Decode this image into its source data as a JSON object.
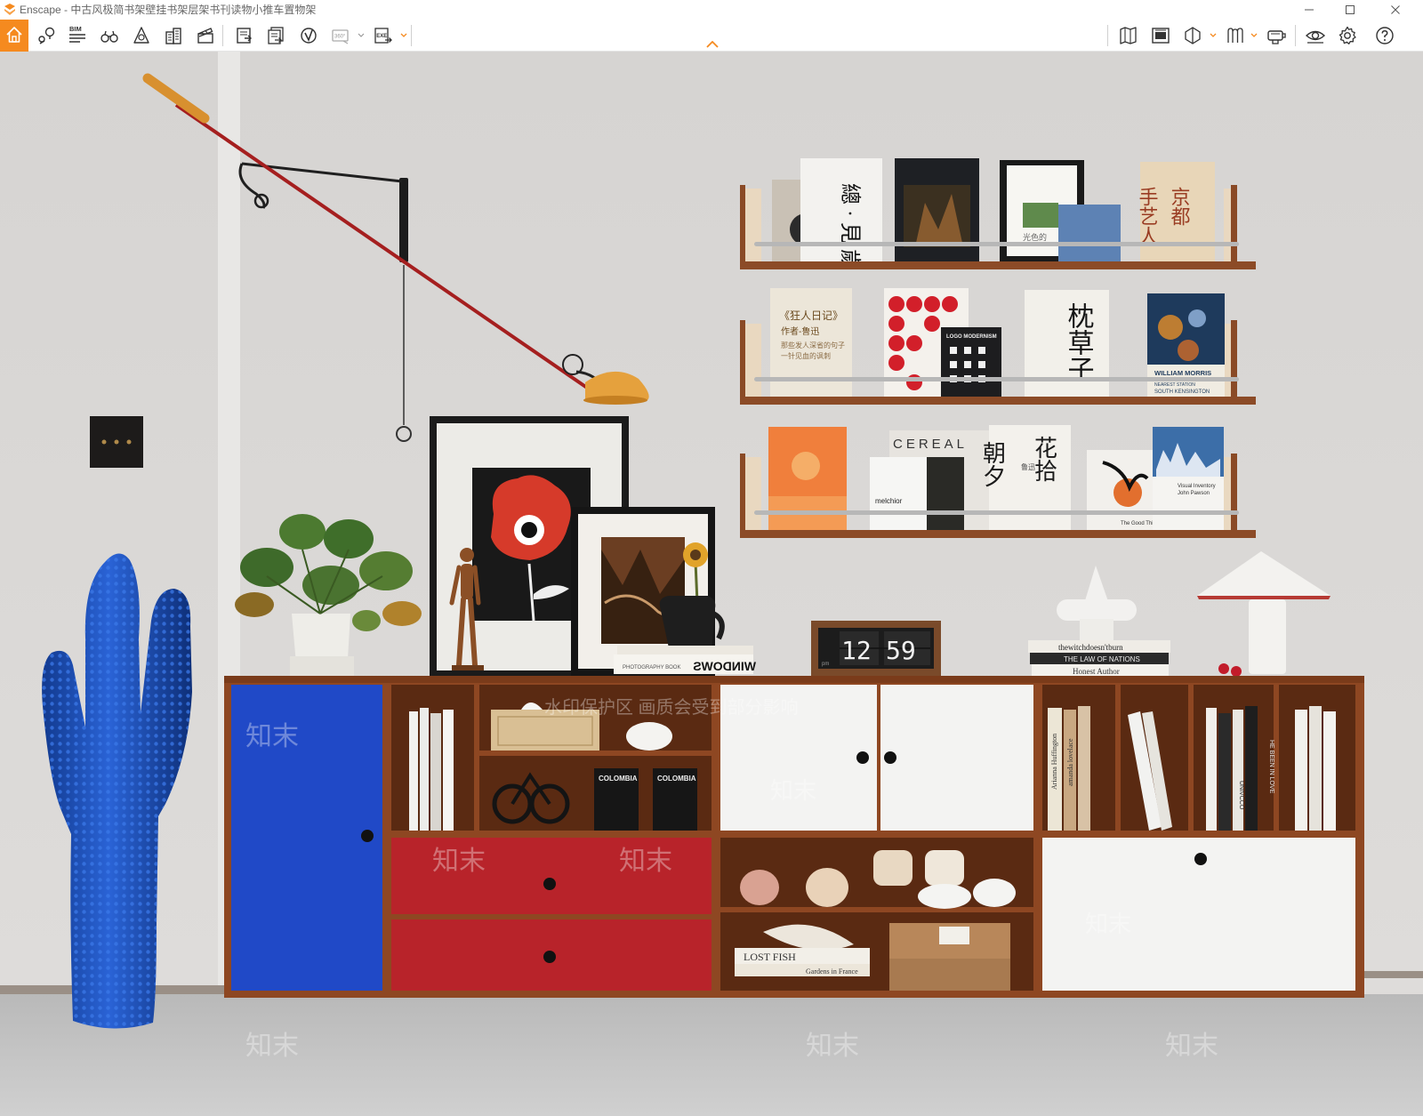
{
  "window": {
    "title": "Enscape - 中古风极简书架壁挂书架层架书刊读物小推车置物架",
    "accent_color": "#f58a1f"
  },
  "toolbar": {
    "left_tools": [
      {
        "icon": "home-icon"
      },
      {
        "icon": "map-pin-icon"
      },
      {
        "icon": "bim-info-icon",
        "label": "BIM"
      },
      {
        "icon": "binoculars-icon"
      },
      {
        "icon": "atmosphere-icon"
      },
      {
        "icon": "buildings-icon"
      },
      {
        "icon": "clapperboard-icon"
      },
      {
        "icon": "screenshot-icon"
      },
      {
        "icon": "batch-render-icon"
      },
      {
        "icon": "web-export-icon"
      },
      {
        "icon": "panorama-360-icon",
        "label": "360°"
      },
      {
        "icon": "exe-export-icon",
        "label": "EXE"
      }
    ],
    "right_tools": [
      {
        "icon": "book-map-icon"
      },
      {
        "icon": "views-icon"
      },
      {
        "icon": "section-icon"
      },
      {
        "icon": "asset-library-icon"
      },
      {
        "icon": "capture-icon"
      },
      {
        "icon": "visibility-eye-icon"
      },
      {
        "icon": "settings-gear-icon"
      },
      {
        "icon": "help-icon"
      }
    ]
  },
  "scene": {
    "clock": {
      "hour": "12",
      "minute": "59",
      "ampm": "pm"
    },
    "watermark": {
      "logo_text": "知末",
      "notice": "水印保护区  画质会受到部分影响"
    },
    "shelf_books": {
      "top": [
        {
          "text_vertical": "總  ·  見  歲"
        },
        {
          "text": ""
        },
        {
          "text": "光色的"
        },
        {
          "text_vertical_1": "手艺人",
          "text_vertical_2": "京都"
        }
      ],
      "middle": [
        {
          "title": "《狂人日记》",
          "author": "作者-鲁迅",
          "line1": "那些发人深省的句子",
          "line2": "一针见血的讽刺"
        },
        {
          "title": "LOGO MODERNISM"
        },
        {
          "text_vertical": "枕草子"
        },
        {
          "title": "WILLIAM MORRIS",
          "subtitle": "NEAREST  STATION",
          "subtitle2": "SOUTH KENSINGTON"
        }
      ],
      "bottom": [
        {
          "title": "CEREAL"
        },
        {
          "title": "melchior"
        },
        {
          "text_vertical_1": "朝夕",
          "text_vertical_2": "花拾",
          "author": "鲁迅"
        },
        {
          "title": "The Good Thing"
        },
        {
          "title": "Visual Inventory",
          "author": "John Pawson"
        }
      ]
    },
    "cabinet_books": {
      "counter_stack": [
        "thewitchdoesn'tburn",
        "THE LAW OF NATIONS",
        "Honest Author"
      ],
      "windows_stack": [
        "WINDOWS",
        "PHOTOGRAPHY BOOK"
      ],
      "right_spines": [
        "Arianna Huffington",
        "amanda lovelace",
        "UNIVCCO",
        "HE BEEN IN LOVE"
      ],
      "coffee_bags": [
        "COLOMBIA",
        "COLOMBIA"
      ],
      "cookbook_stack": [
        "LOST FISH",
        "Gardens in France"
      ]
    }
  }
}
